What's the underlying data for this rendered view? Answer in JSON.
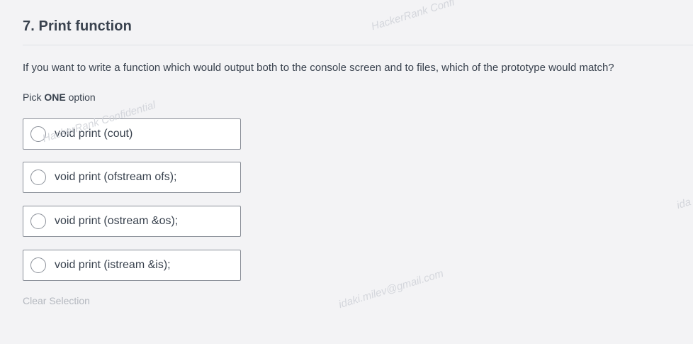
{
  "question": {
    "title": "7. Print function",
    "text": "If you want to write a function which would output both to the console screen and to files, which of the prototype would match?",
    "pick_prefix": "Pick",
    "pick_strong": "ONE",
    "pick_suffix": "option"
  },
  "options": [
    {
      "label": "void print (cout)",
      "selected": false
    },
    {
      "label": "void print (ofstream ofs);",
      "selected": false
    },
    {
      "label": "void print (ostream &os);",
      "selected": false
    },
    {
      "label": "void print (istream &is);",
      "selected": false
    }
  ],
  "clear_selection_label": "Clear Selection",
  "watermarks": {
    "top": "HackerRank Confi",
    "left": "HackerRank Confidential",
    "right": "ida",
    "email": "idaki.milev@gmail.com"
  },
  "colors": {
    "background": "#f3f3f5",
    "text": "#39424e",
    "border": "#8b9099",
    "muted": "#b4b8bf"
  }
}
